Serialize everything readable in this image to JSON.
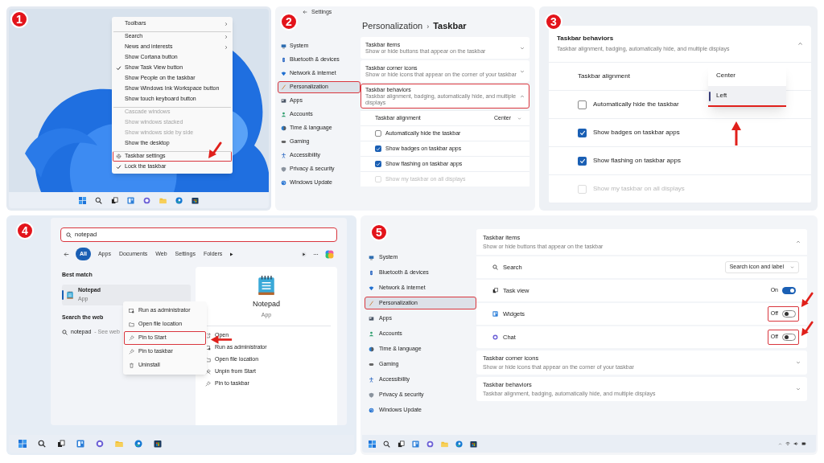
{
  "step_1": {
    "badge": "1",
    "context_menu": [
      {
        "kind": "item",
        "label": "Toolbars",
        "has_submenu": true,
        "checked": false,
        "disabled": false,
        "highlighted": false,
        "divider_before": false
      },
      {
        "kind": "item",
        "label": "Search",
        "has_submenu": true,
        "checked": false,
        "disabled": false,
        "highlighted": false,
        "divider_before": true
      },
      {
        "kind": "item",
        "label": "News and interests",
        "has_submenu": true,
        "checked": false,
        "disabled": false,
        "highlighted": false,
        "divider_before": false
      },
      {
        "kind": "item",
        "label": "Show Cortana button",
        "has_submenu": false,
        "checked": false,
        "disabled": false,
        "highlighted": false,
        "divider_before": false
      },
      {
        "kind": "item",
        "label": "Show Task View button",
        "has_submenu": false,
        "checked": true,
        "disabled": false,
        "highlighted": false,
        "divider_before": false
      },
      {
        "kind": "item",
        "label": "Show People on the taskbar",
        "has_submenu": false,
        "checked": false,
        "disabled": false,
        "highlighted": false,
        "divider_before": false
      },
      {
        "kind": "item",
        "label": "Show Windows Ink Workspace button",
        "has_submenu": false,
        "checked": false,
        "disabled": false,
        "highlighted": false,
        "divider_before": false
      },
      {
        "kind": "item",
        "label": "Show touch keyboard button",
        "has_submenu": false,
        "checked": false,
        "disabled": false,
        "highlighted": false,
        "divider_before": false
      },
      {
        "kind": "item",
        "label": "Cascade windows",
        "has_submenu": false,
        "checked": false,
        "disabled": true,
        "highlighted": false,
        "divider_before": true
      },
      {
        "kind": "item",
        "label": "Show windows stacked",
        "has_submenu": false,
        "checked": false,
        "disabled": true,
        "highlighted": false,
        "divider_before": false
      },
      {
        "kind": "item",
        "label": "Show windows side by side",
        "has_submenu": false,
        "checked": false,
        "disabled": true,
        "highlighted": false,
        "divider_before": false
      },
      {
        "kind": "item",
        "label": "Show the desktop",
        "has_submenu": false,
        "checked": false,
        "disabled": false,
        "highlighted": false,
        "divider_before": false
      },
      {
        "kind": "settings",
        "label": "Taskbar settings",
        "has_submenu": false,
        "checked": false,
        "disabled": false,
        "highlighted": true,
        "divider_before": true
      },
      {
        "kind": "item",
        "label": "Lock the taskbar",
        "has_submenu": false,
        "checked": true,
        "disabled": false,
        "highlighted": false,
        "divider_before": false
      }
    ]
  },
  "step_2": {
    "badge": "2",
    "window_title": "Settings",
    "breadcrumb": {
      "parent": "Personalization",
      "separator": "›",
      "current": "Taskbar"
    },
    "nav": [
      {
        "label": "System",
        "selected": false,
        "highlighted": false
      },
      {
        "label": "Bluetooth & devices",
        "selected": false,
        "highlighted": false
      },
      {
        "label": "Network & internet",
        "selected": false,
        "highlighted": false
      },
      {
        "label": "Personalization",
        "selected": true,
        "highlighted": true
      },
      {
        "label": "Apps",
        "selected": false,
        "highlighted": false
      },
      {
        "label": "Accounts",
        "selected": false,
        "highlighted": false
      },
      {
        "label": "Time & language",
        "selected": false,
        "highlighted": false
      },
      {
        "label": "Gaming",
        "selected": false,
        "highlighted": false
      },
      {
        "label": "Accessibility",
        "selected": false,
        "highlighted": false
      },
      {
        "label": "Privacy & security",
        "selected": false,
        "highlighted": false
      },
      {
        "label": "Windows Update",
        "selected": false,
        "highlighted": false
      }
    ],
    "sections": [
      {
        "title": "Taskbar items",
        "subtitle": "Show or hide buttons that appear on the taskbar",
        "expanded": false,
        "highlighted": false
      },
      {
        "title": "Taskbar corner icons",
        "subtitle": "Show or hide icons that appear on the corner of your taskbar",
        "expanded": false,
        "highlighted": false
      },
      {
        "title": "Taskbar behaviors",
        "subtitle": "Taskbar alignment, badging, automatically hide, and multiple displays",
        "expanded": true,
        "highlighted": true,
        "rows": [
          {
            "kind": "dropdown",
            "label": "Taskbar alignment",
            "value": "Center"
          },
          {
            "kind": "checkbox",
            "label": "Automatically hide the taskbar",
            "checked": false,
            "disabled": false
          },
          {
            "kind": "checkbox",
            "label": "Show badges on taskbar apps",
            "checked": true,
            "disabled": false
          },
          {
            "kind": "checkbox",
            "label": "Show flashing on taskbar apps",
            "checked": true,
            "disabled": false
          },
          {
            "kind": "checkbox",
            "label": "Show my taskbar on all displays",
            "checked": false,
            "disabled": true
          }
        ]
      }
    ]
  },
  "step_3": {
    "badge": "3",
    "section": {
      "title": "Taskbar behaviors",
      "subtitle": "Taskbar alignment, badging, automatically hide, and multiple displays",
      "expanded": true
    },
    "rows": [
      {
        "kind": "dropdown",
        "label": "Taskbar alignment",
        "options": [
          {
            "label": "Center",
            "selected": false
          },
          {
            "label": "Left",
            "selected": true
          }
        ]
      },
      {
        "kind": "checkbox",
        "label": "Automatically hide the taskbar",
        "checked": false,
        "disabled": false
      },
      {
        "kind": "checkbox",
        "label": "Show badges on taskbar apps",
        "checked": true,
        "disabled": false
      },
      {
        "kind": "checkbox",
        "label": "Show flashing on taskbar apps",
        "checked": true,
        "disabled": false
      },
      {
        "kind": "checkbox",
        "label": "Show my taskbar on all displays",
        "checked": false,
        "disabled": true
      }
    ]
  },
  "step_4": {
    "badge": "4",
    "search": {
      "value": "notepad",
      "highlighted": true
    },
    "filters": [
      {
        "label": "All",
        "selected": true
      },
      {
        "label": "Apps",
        "selected": false
      },
      {
        "label": "Documents",
        "selected": false
      },
      {
        "label": "Web",
        "selected": false
      },
      {
        "label": "Settings",
        "selected": false
      },
      {
        "label": "Folders",
        "selected": false
      }
    ],
    "best_match": {
      "heading": "Best match",
      "name": "Notepad",
      "type": "App"
    },
    "web": {
      "heading": "Search the web",
      "query": "notepad",
      "suffix": "- See web"
    },
    "context_menu": [
      {
        "kind": "admin",
        "label": "Run as administrator",
        "highlighted": false
      },
      {
        "kind": "folder",
        "label": "Open file location",
        "highlighted": false
      },
      {
        "kind": "pin",
        "label": "Pin to Start",
        "highlighted": true
      },
      {
        "kind": "pin",
        "label": "Pin to taskbar",
        "highlighted": false
      },
      {
        "kind": "trash",
        "label": "Uninstall",
        "highlighted": false
      }
    ],
    "details": {
      "name": "Notepad",
      "type": "App",
      "actions": [
        {
          "kind": "open",
          "label": "Open"
        },
        {
          "kind": "admin",
          "label": "Run as administrator"
        },
        {
          "kind": "folder",
          "label": "Open file location"
        },
        {
          "kind": "unpin",
          "label": "Unpin from Start"
        },
        {
          "kind": "pin",
          "label": "Pin to taskbar"
        }
      ]
    }
  },
  "step_5": {
    "badge": "5",
    "nav": [
      {
        "label": "System",
        "selected": false,
        "highlighted": false
      },
      {
        "label": "Bluetooth & devices",
        "selected": false,
        "highlighted": false
      },
      {
        "label": "Network & internet",
        "selected": false,
        "highlighted": false
      },
      {
        "label": "Personalization",
        "selected": true,
        "highlighted": true
      },
      {
        "label": "Apps",
        "selected": false,
        "highlighted": false
      },
      {
        "label": "Accounts",
        "selected": false,
        "highlighted": false
      },
      {
        "label": "Time & language",
        "selected": false,
        "highlighted": false
      },
      {
        "label": "Gaming",
        "selected": false,
        "highlighted": false
      },
      {
        "label": "Accessibility",
        "selected": false,
        "highlighted": false
      },
      {
        "label": "Privacy & security",
        "selected": false,
        "highlighted": false
      },
      {
        "label": "Windows Update",
        "selected": false,
        "highlighted": false
      }
    ],
    "sections": [
      {
        "title": "Taskbar items",
        "subtitle": "Show or hide buttons that appear on the taskbar",
        "expanded": true,
        "rows": [
          {
            "kind": "dropdown",
            "label": "Search",
            "value": "Search icon and label"
          },
          {
            "kind": "toggle",
            "label": "Task view",
            "on": true,
            "state_text": "On",
            "highlighted": false
          },
          {
            "kind": "toggle",
            "label": "Widgets",
            "on": false,
            "state_text": "Off",
            "highlighted": true
          },
          {
            "kind": "toggle",
            "label": "Chat",
            "on": false,
            "state_text": "Off",
            "highlighted": true
          }
        ]
      },
      {
        "title": "Taskbar corner icons",
        "subtitle": "Show or hide icons that appear on the corner of your taskbar",
        "expanded": false
      },
      {
        "title": "Taskbar behaviors",
        "subtitle": "Taskbar alignment, badging, automatically hide, and multiple displays",
        "expanded": false
      }
    ]
  }
}
